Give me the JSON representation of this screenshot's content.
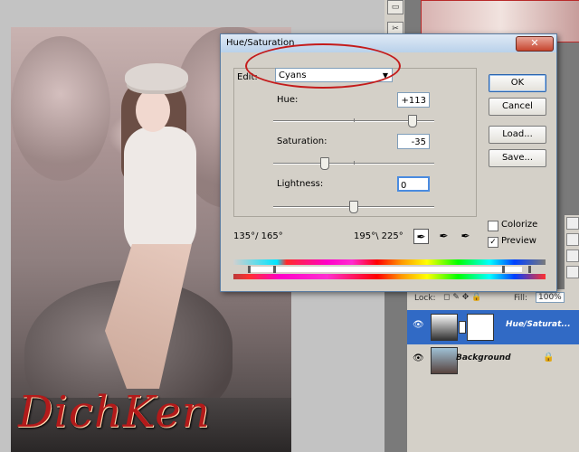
{
  "dialog": {
    "title": "Hue/Saturation",
    "close_label": "✕",
    "edit_label": "Edit:",
    "edit_value": "Cyans",
    "hue_label": "Hue:",
    "hue_value": "+113",
    "saturation_label": "Saturation:",
    "saturation_value": "-35",
    "lightness_label": "Lightness:",
    "lightness_value": "0",
    "buttons": {
      "ok": "OK",
      "cancel": "Cancel",
      "load": "Load...",
      "save": "Save..."
    },
    "colorize_label": "Colorize",
    "colorize_checked": false,
    "preview_label": "Preview",
    "preview_checked": true,
    "range_left": "135°/ 165°",
    "range_right": "195°\\ 225°"
  },
  "layers": {
    "lock_label": "Lock:",
    "fill_label": "Fill:",
    "fill_value": "100%",
    "items": [
      {
        "name": "Hue/Saturat...",
        "selected": true
      },
      {
        "name": "Background",
        "selected": false
      }
    ]
  },
  "watermark": "DichKen",
  "colors": {
    "accent_red": "#c41b1b",
    "layer_selected": "#316ac5"
  }
}
